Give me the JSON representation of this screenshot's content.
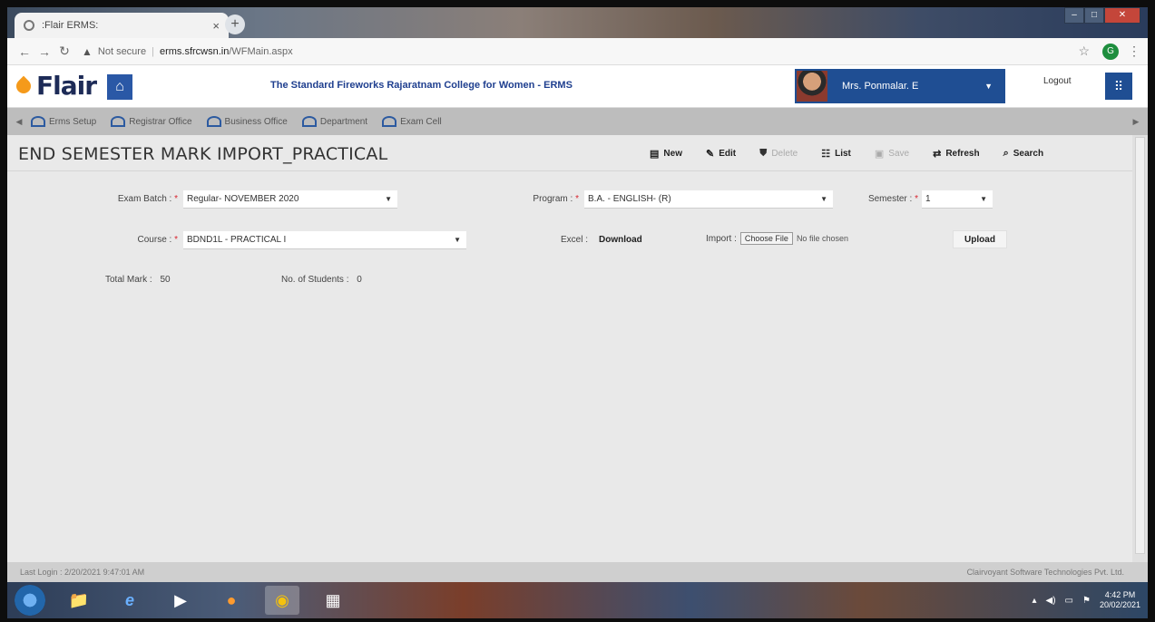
{
  "browser": {
    "tab_title": ":Flair ERMS:",
    "tab_close": "×",
    "new_tab": "+",
    "win_min": "–",
    "win_max": "□",
    "win_close": "✕",
    "security_text": "Not secure",
    "url_host": "erms.sfrcwsn.in",
    "url_path": "/WFMain.aspx",
    "profile_initial": "G"
  },
  "header": {
    "logo_text": "Flair",
    "college_name": "The Standard Fireworks Rajaratnam College for Women - ERMS",
    "user_name": "Mrs. Ponmalar. E",
    "logout_label": "Logout"
  },
  "menu": {
    "items": [
      {
        "label": "Erms Setup"
      },
      {
        "label": "Registrar Office"
      },
      {
        "label": "Business Office"
      },
      {
        "label": "Department"
      },
      {
        "label": "Exam Cell"
      }
    ]
  },
  "page": {
    "title": "END SEMESTER MARK IMPORT_PRACTICAL"
  },
  "toolbar": {
    "new": "New",
    "edit": "Edit",
    "delete": "Delete",
    "list": "List",
    "save": "Save",
    "refresh": "Refresh",
    "search": "Search"
  },
  "form": {
    "exam_batch_label": "Exam Batch :",
    "exam_batch_value": "Regular- NOVEMBER 2020",
    "program_label": "Program :",
    "program_value": "B.A. - ENGLISH- (R)",
    "semester_label": "Semester :",
    "semester_value": "1",
    "course_label": "Course :",
    "course_value": "BDND1L - PRACTICAL I",
    "excel_label": "Excel :",
    "download_label": "Download",
    "import_label": "Import :",
    "choose_file_label": "Choose File",
    "no_file_text": "No file chosen",
    "upload_label": "Upload",
    "required_mark": "*",
    "total_mark_label": "Total Mark :",
    "total_mark_value": "50",
    "students_label": "No. of Students :",
    "students_value": "0"
  },
  "footer": {
    "last_login": "Last Login : 2/20/2021 9:47:01 AM",
    "company": "Clairvoyant Software Technologies Pvt. Ltd."
  },
  "taskbar": {
    "time": "4:42 PM",
    "date": "20/02/2021"
  },
  "colors": {
    "brand_blue": "#1f4e93",
    "logo_orange": "#f59a1b",
    "required_red": "#d9232d"
  }
}
